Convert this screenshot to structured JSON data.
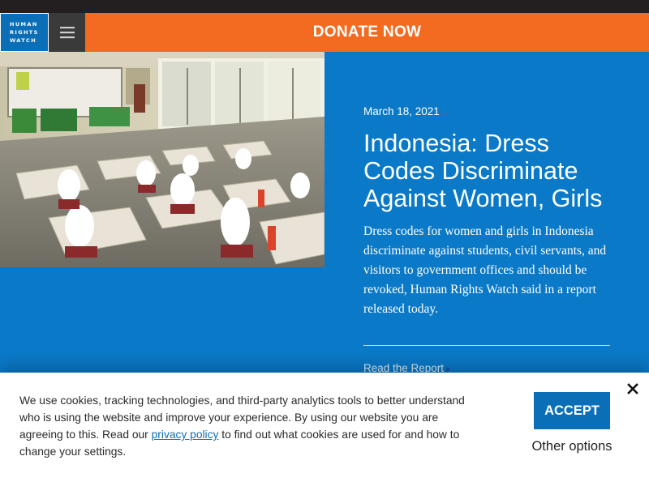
{
  "header": {
    "logo_lines": [
      "HUMAN",
      "RIGHTS",
      "WATCH"
    ],
    "menu_icon": "hamburger-menu-icon",
    "donate_label": "DONATE NOW"
  },
  "article": {
    "date": "March 18, 2021",
    "title": "Indonesia: Dress Codes Discriminate Against Women, Girls",
    "summary": "Dress codes for women and girls in Indonesia discriminate against students, civil servants, and visitors to government offices and should be revoked, Human Rights Watch said in a report released today.",
    "link_label": "Read the Report",
    "link_icon": "chevron-right-icon"
  },
  "cookie_banner": {
    "text_before_link": "We use cookies, tracking technologies, and third-party analytics tools to better understand who is using the website and improve your experience. By using our website you are agreeing to this. Read our ",
    "link_text": "privacy policy",
    "text_after_link": " to find out what cookies are used for and how to change your settings.",
    "accept_label": "ACCEPT",
    "other_label": "Other options",
    "close_icon": "close-icon"
  },
  "colors": {
    "brand_blue": "#0a79c7",
    "donate_orange": "#f26b20",
    "top_bar": "#231f20",
    "accept_blue": "#0b6fb8"
  }
}
